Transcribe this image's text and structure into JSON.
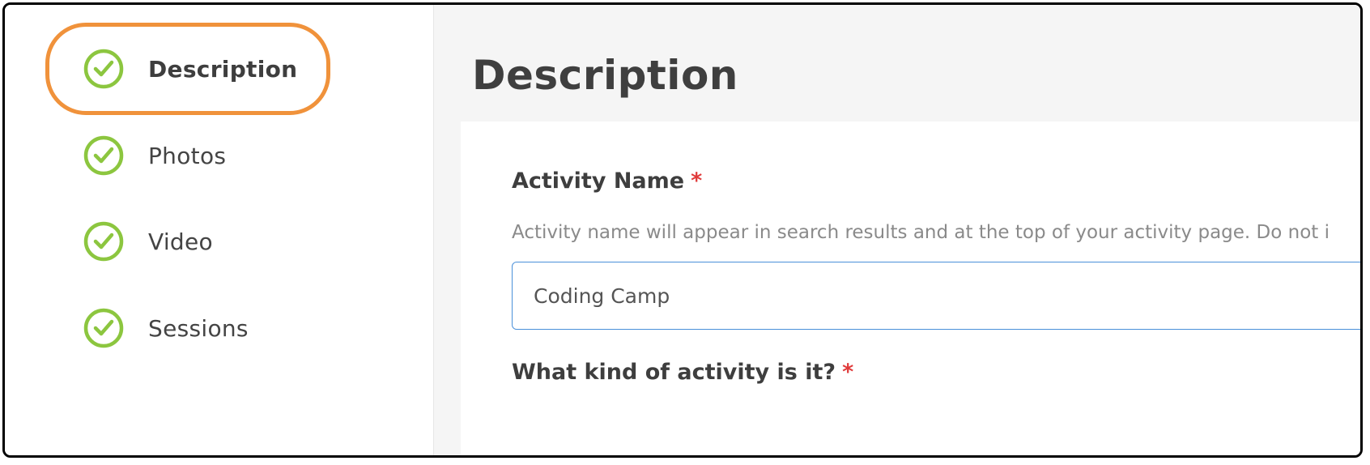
{
  "sidebar": {
    "items": [
      {
        "label": "Description",
        "icon": "check-circle-icon",
        "active": true
      },
      {
        "label": "Photos",
        "icon": "check-circle-icon",
        "active": false
      },
      {
        "label": "Video",
        "icon": "check-circle-icon",
        "active": false
      },
      {
        "label": "Sessions",
        "icon": "check-circle-icon",
        "active": false
      }
    ]
  },
  "main": {
    "title": "Description",
    "activity_name": {
      "label": "Activity Name",
      "required_mark": "*",
      "help_text": "Activity name will appear in search results and at the top of your activity page. Do not i",
      "value": "Coding Camp"
    },
    "activity_kind": {
      "label": "What kind of activity is it?",
      "required_mark": "*"
    }
  },
  "colors": {
    "check_green": "#8cc63f",
    "highlight_orange": "#f0923b",
    "required_red": "#e03a3a",
    "input_border_blue": "#4a90d9"
  }
}
